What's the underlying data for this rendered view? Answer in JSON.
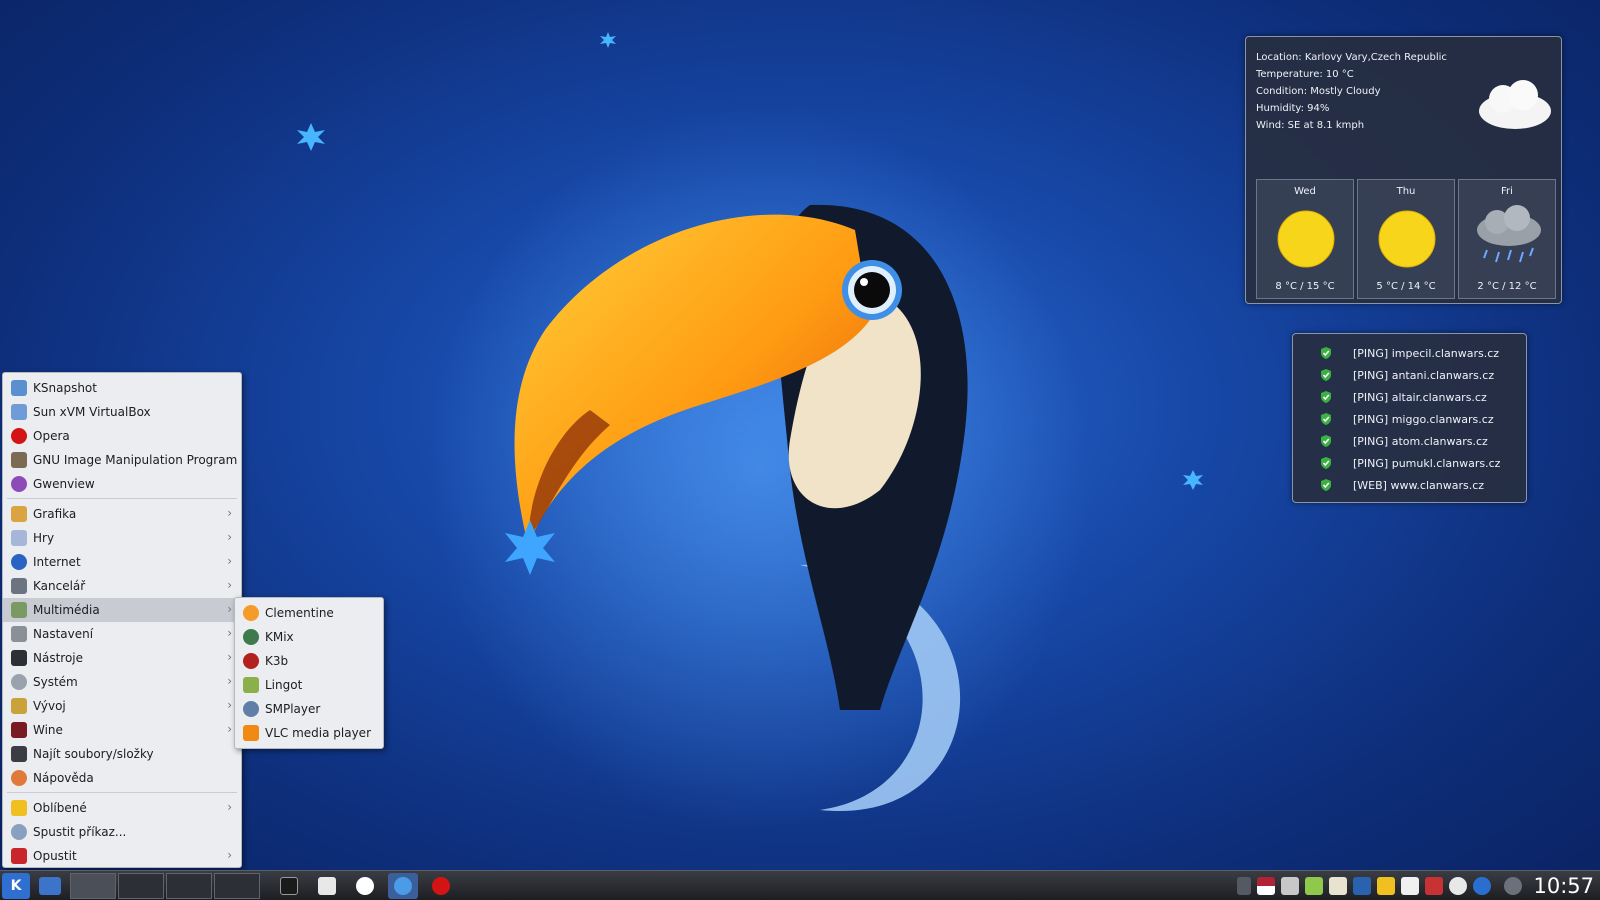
{
  "weather": {
    "location": "Location: Karlovy Vary,Czech Republic",
    "temperature": "Temperature: 10 °C",
    "condition": "Condition: Mostly Cloudy",
    "humidity": "Humidity: 94%",
    "wind": "Wind: SE at 8.1 kmph",
    "days": [
      {
        "name": "Wed",
        "temp": "8 °C / 15 °C",
        "icon": "sun-icon"
      },
      {
        "name": "Thu",
        "temp": "5 °C / 14 °C",
        "icon": "sun-icon"
      },
      {
        "name": "Fri",
        "temp": "2 °C / 12 °C",
        "icon": "rain-icon"
      }
    ]
  },
  "ping": {
    "items": [
      "[PING] impecil.clanwars.cz",
      "[PING] antani.clanwars.cz",
      "[PING] altair.clanwars.cz",
      "[PING] miggo.clanwars.cz",
      "[PING] atom.clanwars.cz",
      "[PING] pumukl.clanwars.cz",
      "[WEB] www.clanwars.cz"
    ]
  },
  "menu": {
    "recent": [
      "KSnapshot",
      "Sun xVM VirtualBox",
      "Opera",
      "GNU Image Manipulation Program",
      "Gwenview"
    ],
    "categories": [
      "Grafika",
      "Hry",
      "Internet",
      "Kancelář",
      "Multimédia",
      "Nastavení",
      "Nástroje",
      "Systém",
      "Vývoj",
      "Wine"
    ],
    "find": "Najít soubory/složky",
    "help": "Nápověda",
    "favorites": "Oblíbené",
    "run": "Spustit příkaz...",
    "quit": "Opustit",
    "arrow": "›"
  },
  "submenu": {
    "items": [
      "Clementine",
      "KMix",
      "K3b",
      "Lingot",
      "SMPlayer",
      "VLC media player"
    ]
  },
  "taskbar": {
    "clock": "10:57"
  },
  "colors": {
    "accent": "#1b4fb0",
    "shield": "#3cb043",
    "sun": "#f7d51a"
  }
}
